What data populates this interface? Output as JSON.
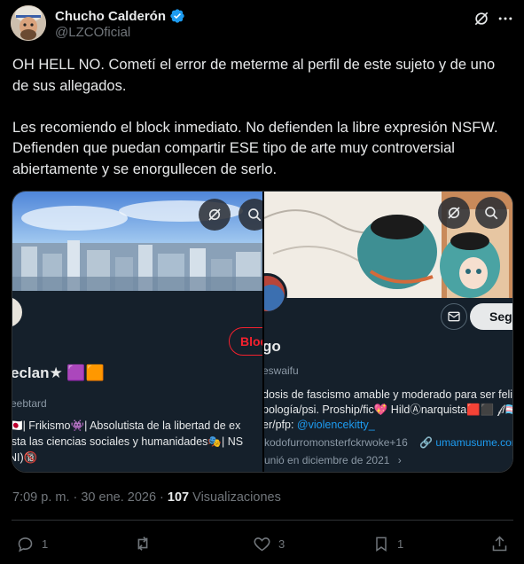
{
  "author": {
    "display_name": "Chucho Calderón",
    "handle": "@LZCOficial"
  },
  "tweet": {
    "paragraphs": [
      "OH HELL NO. Cometí el error de meterme al perfil de este sujeto y de uno de sus allegados.",
      "Les recomiendo el block inmediato. No defienden la libre expresión NSFW. Defienden que puedan compartir ESE tipo de arte muy controversial abiertamente y se enorgullecen de serlo."
    ]
  },
  "media": {
    "left": {
      "follow_label": "Bloq",
      "name": "eclan★ 🟪🟧",
      "handle": "eebtard",
      "bio_lines": [
        "🇯🇵| Frikismo👾| Absolutista de la libertad de ex",
        "ista las ciencias sociales y humanidades🎭| NS",
        "NI)🔞"
      ]
    },
    "right": {
      "follow_label": "Segu",
      "name": "go",
      "handle": "eswaifu",
      "bio_lines": [
        "dosis de fascismo amable y moderado para ser feliz  E",
        "pología/psi. Proship/fic💖 HildⒶnarquista🟥⬛ 𝒻/🏳️‍⚧️(sa",
        "er/pfp: "
      ],
      "bio_mention": "@violencekitty_",
      "meta_tags": "kodofurromonsterfckrwoke+16",
      "meta_link": "umamusume.com",
      "joined": "unió en diciembre de 2021"
    }
  },
  "meta": {
    "time": "7:09 p. m. · 30 ene. 2026 · ",
    "views_count": "107",
    "views_label": " Visualizaciones"
  },
  "actions": {
    "replies": "1",
    "reposts": "",
    "likes": "3",
    "bookmarks": "1"
  },
  "colors": {
    "accent": "#1d9bf0",
    "text": "#e7e9ea",
    "muted": "#71767b",
    "block_red": "#f4212e"
  }
}
